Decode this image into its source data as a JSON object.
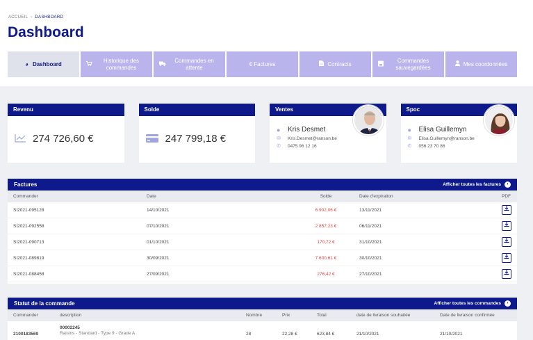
{
  "breadcrumb": {
    "home": "ACCUEIL",
    "sep": "›",
    "current": "DASHBOARD"
  },
  "page_title": "Dashboard",
  "tabs": [
    {
      "label": "Dashboard",
      "icon": "gauge-icon",
      "glyph": "◕",
      "active": true
    },
    {
      "label": "Historique des commandes",
      "icon": "cart-icon",
      "glyph": "🛒"
    },
    {
      "label": "Commandes en attente",
      "icon": "truck-icon",
      "glyph": "▰"
    },
    {
      "label": "€ Factures",
      "icon": "",
      "glyph": ""
    },
    {
      "label": "Contracts",
      "icon": "document-icon",
      "glyph": "▤"
    },
    {
      "label": "Commandes sauvegardées",
      "icon": "save-icon",
      "glyph": "▣"
    },
    {
      "label": "Mes coordonnées",
      "icon": "user-icon",
      "glyph": "●"
    }
  ],
  "cards": {
    "revenu": {
      "title": "Revenu",
      "value": "274 726,60 €",
      "icon": "chart-line-icon"
    },
    "solde": {
      "title": "Solde",
      "value": "247 799,18 €",
      "icon": "credit-card-icon"
    },
    "ventes": {
      "title": "Ventes",
      "name": "Kris Desmet",
      "email": "Kris.Desmet@ranson.be",
      "phone": "0475 96 12 16"
    },
    "spoc": {
      "title": "Spoc",
      "name": "Elisa Guillemyn",
      "email": "Elisa.Guillemyn@ranson.be",
      "phone": "056 23 70 86"
    }
  },
  "factures": {
    "title": "Factures",
    "link": "Afficher toutes les factures",
    "columns": {
      "commander": "Commander",
      "date": "Date",
      "solde": "Solde",
      "expiration": "Date d'expiration",
      "pdf": "PDF"
    },
    "rows": [
      {
        "id": "SI2021-095128",
        "date": "14/10/2021",
        "solde": "6 902,06 €",
        "exp": "13/11/2021"
      },
      {
        "id": "SI2021-092558",
        "date": "07/10/2021",
        "solde": "2 857,23 €",
        "exp": "06/11/2021"
      },
      {
        "id": "SI2021-090713",
        "date": "01/10/2021",
        "solde": "170,72 €",
        "exp": "31/10/2021"
      },
      {
        "id": "SI2021-089819",
        "date": "30/09/2021",
        "solde": "7 600,61 €",
        "exp": "30/10/2021"
      },
      {
        "id": "SI2021-088458",
        "date": "27/09/2021",
        "solde": "276,42 €",
        "exp": "27/10/2021"
      }
    ]
  },
  "statut": {
    "title": "Statut de la commande",
    "link": "Afficher toutes les commandes",
    "columns": {
      "commander": "Commander",
      "description": "description",
      "nombre": "Nombre",
      "prix": "Prix",
      "total": "Total",
      "souhaitee": "date de livraison souhaitée",
      "confirmee": "Date de livraison confirmée"
    },
    "rows": [
      {
        "commander": "2100183569",
        "code": "00002245",
        "desc": "Raisins - Standard - Type 9 - Grade A",
        "nombre": "28",
        "prix": "22,28 €",
        "total": "623,84 €",
        "souhaitee": "21/10/2021",
        "confirmee": "21/10/2021"
      }
    ]
  }
}
